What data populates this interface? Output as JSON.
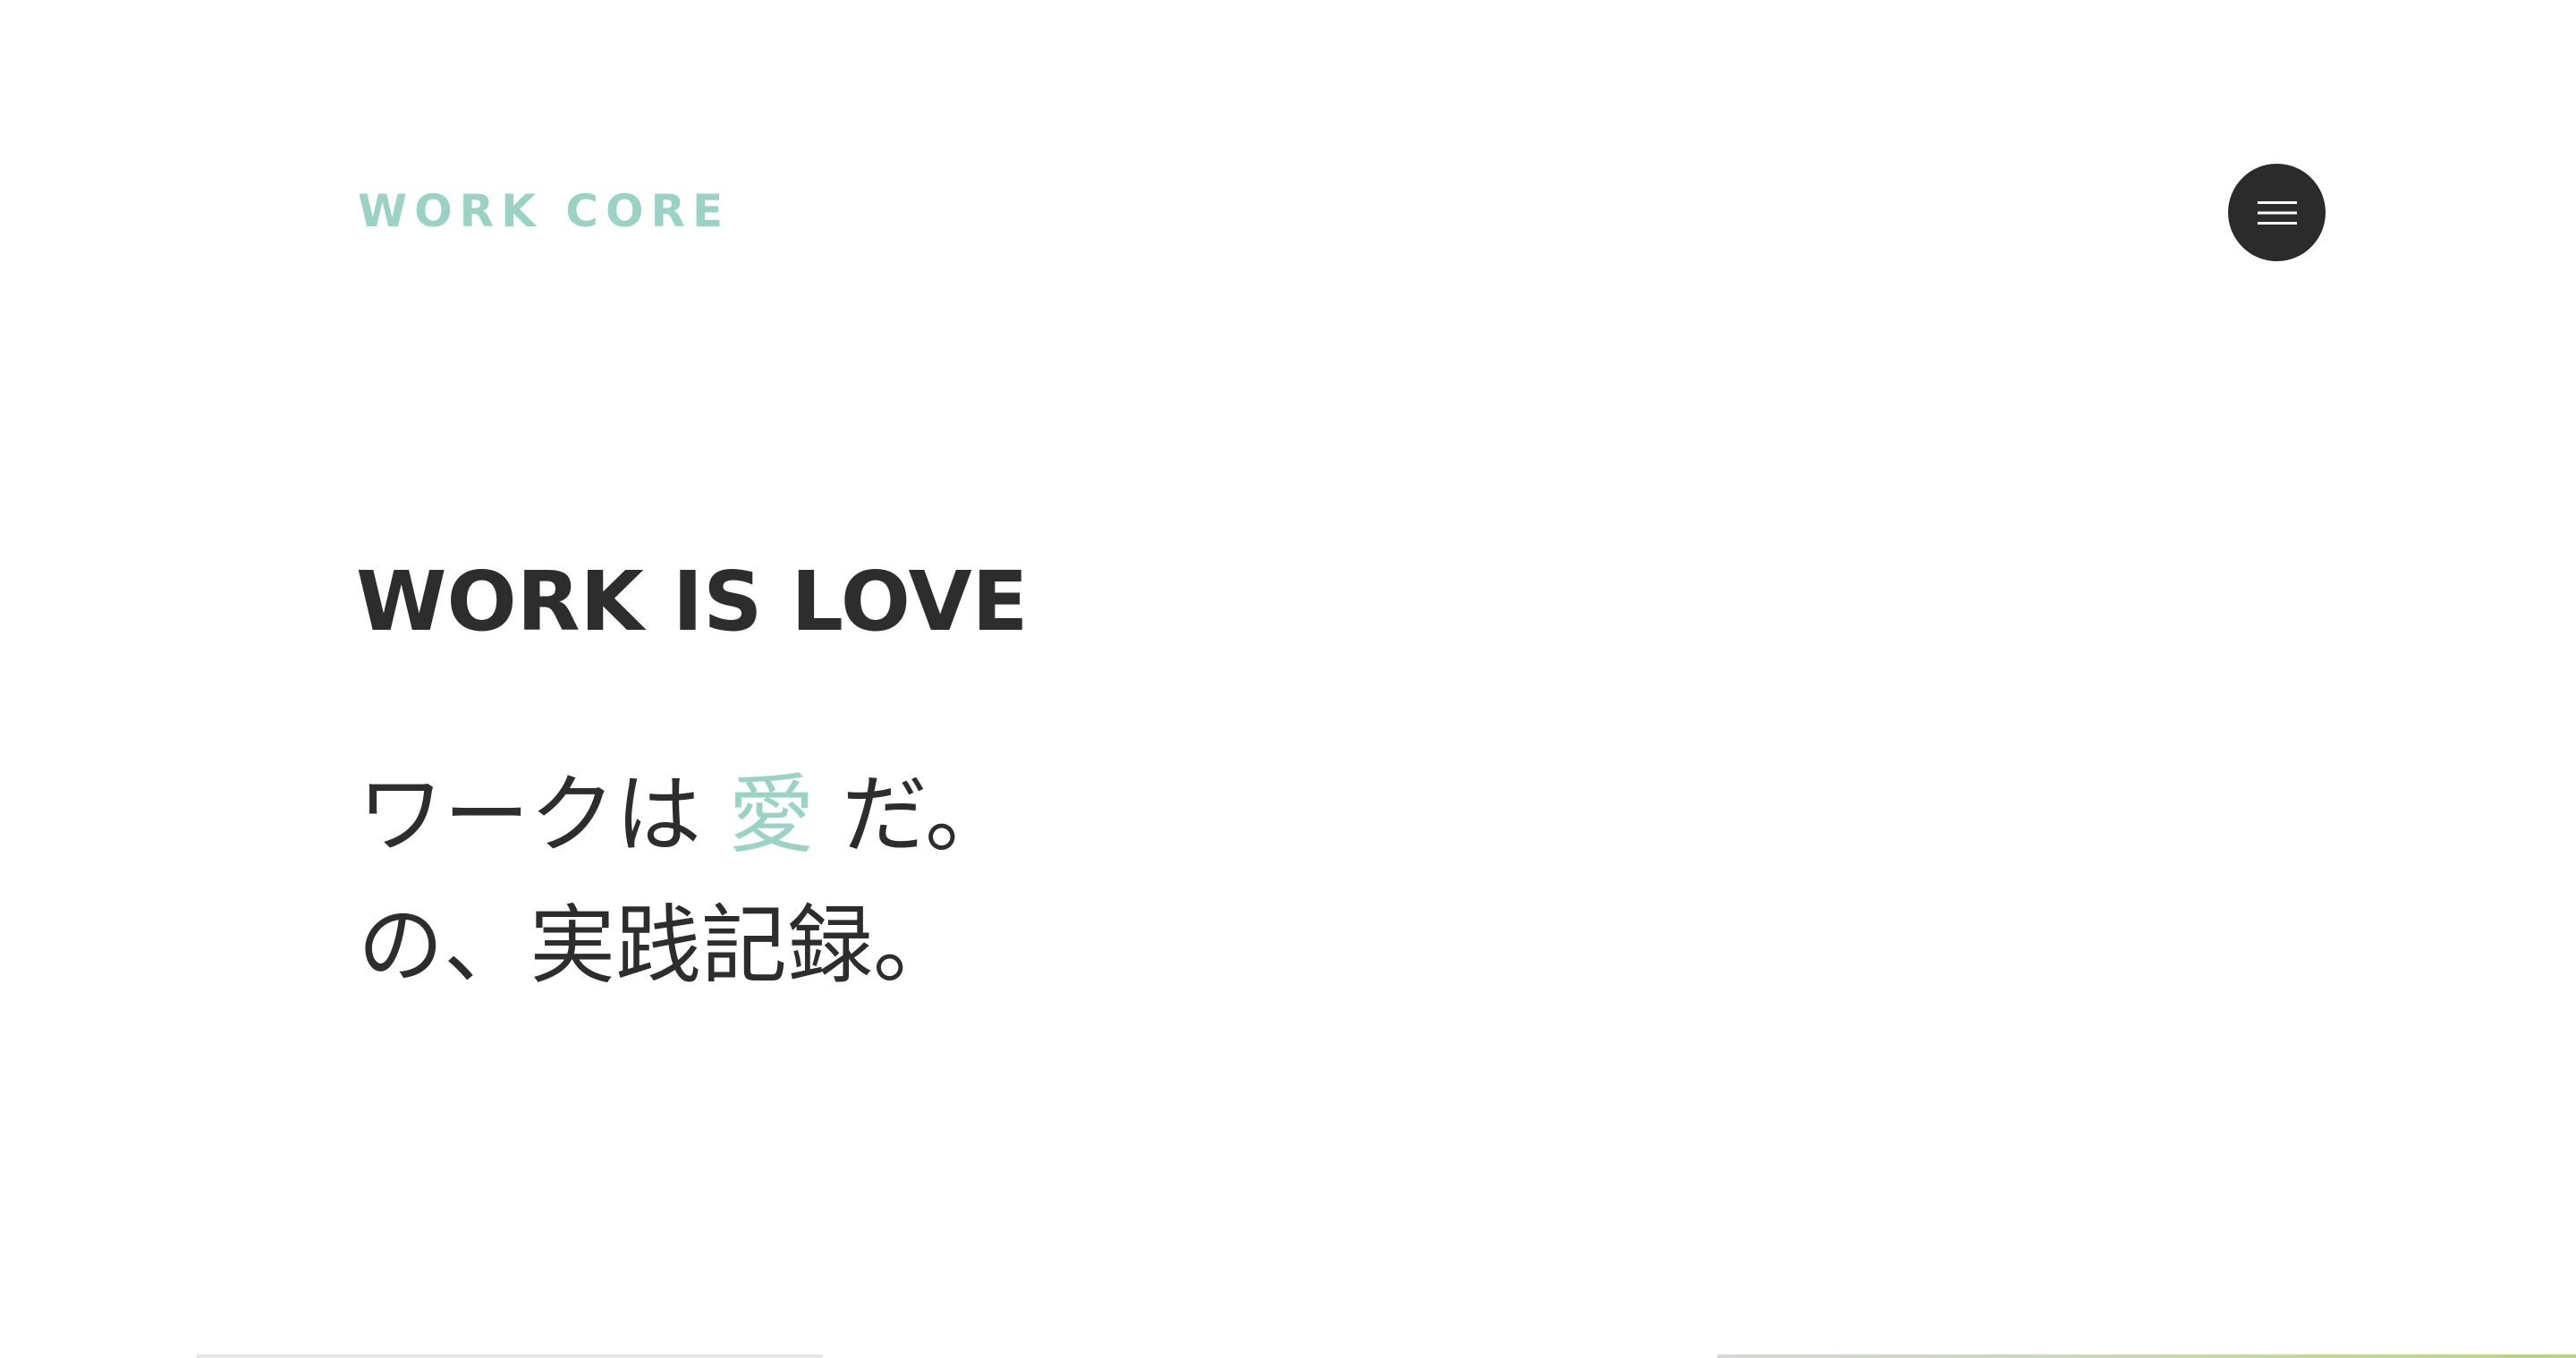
{
  "header": {
    "logo_text": "WORK CORE",
    "menu_icon": "hamburger-menu-icon"
  },
  "hero": {
    "title": "WORK IS LOVE",
    "subtitle_line1_before": "ワークは ",
    "subtitle_line1_accent": "愛",
    "subtitle_line1_after": " だ。",
    "subtitle_line2": "の、実践記録。"
  },
  "colors": {
    "accent": "#9bd2c6",
    "text": "#2d2d2d",
    "menu_button": "#2b2b2b",
    "background": "#ffffff"
  }
}
